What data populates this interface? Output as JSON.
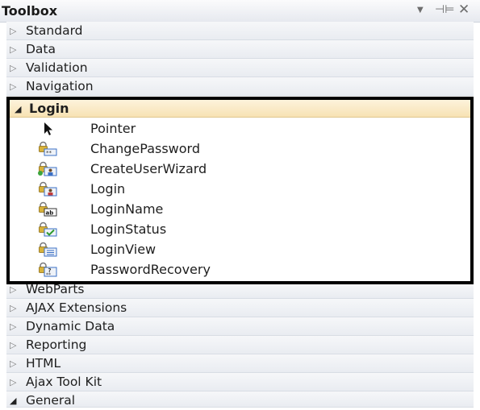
{
  "window": {
    "title": "Toolbox",
    "dropdown_glyph": "▼",
    "pin_glyph": "⊣⊨",
    "close_glyph": "✕"
  },
  "categories_above": [
    {
      "label": "Standard",
      "expanded": false
    },
    {
      "label": "Data",
      "expanded": false
    },
    {
      "label": "Validation",
      "expanded": false
    },
    {
      "label": "Navigation",
      "expanded": false
    }
  ],
  "login_group": {
    "label": "Login",
    "expanded": true,
    "tools": [
      {
        "label": "Pointer",
        "icon": "pointer-arrow-icon"
      },
      {
        "label": "ChangePassword",
        "icon": "change-password-icon"
      },
      {
        "label": "CreateUserWizard",
        "icon": "create-user-wizard-icon"
      },
      {
        "label": "Login",
        "icon": "login-control-icon"
      },
      {
        "label": "LoginName",
        "icon": "login-name-icon"
      },
      {
        "label": "LoginStatus",
        "icon": "login-status-icon"
      },
      {
        "label": "LoginView",
        "icon": "login-view-icon"
      },
      {
        "label": "PasswordRecovery",
        "icon": "password-recovery-icon"
      }
    ]
  },
  "categories_below": [
    {
      "label": "WebParts",
      "expanded": false
    },
    {
      "label": "AJAX Extensions",
      "expanded": false
    },
    {
      "label": "Dynamic Data",
      "expanded": false
    },
    {
      "label": "Reporting",
      "expanded": false
    },
    {
      "label": "HTML",
      "expanded": false
    },
    {
      "label": "Ajax Tool Kit",
      "expanded": false
    },
    {
      "label": "General",
      "expanded": true
    }
  ],
  "glyphs": {
    "collapsed": "▷",
    "expanded": "◢"
  },
  "colors": {
    "highlight_border": "#000000",
    "selected_header": "#f7e2b3",
    "lock_gold": "#d9b23a",
    "lock_blue": "#3a6fc4"
  }
}
